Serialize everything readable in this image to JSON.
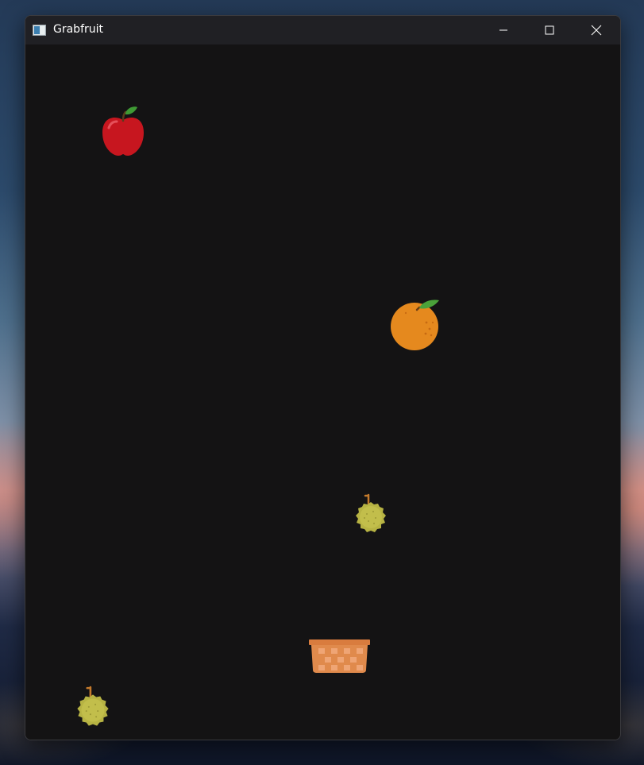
{
  "window": {
    "title": "Grabfruit",
    "controls": {
      "minimize": "minimize-icon",
      "maximize": "maximize-icon",
      "close": "close-icon"
    }
  },
  "game": {
    "background_color": "#141314",
    "fruits": [
      {
        "kind": "apple",
        "icon": "apple-icon"
      },
      {
        "kind": "orange",
        "icon": "orange-icon"
      },
      {
        "kind": "durian",
        "icon": "durian-icon"
      },
      {
        "kind": "durian",
        "icon": "durian-icon"
      }
    ],
    "player": {
      "kind": "basket",
      "icon": "basket-icon"
    }
  }
}
